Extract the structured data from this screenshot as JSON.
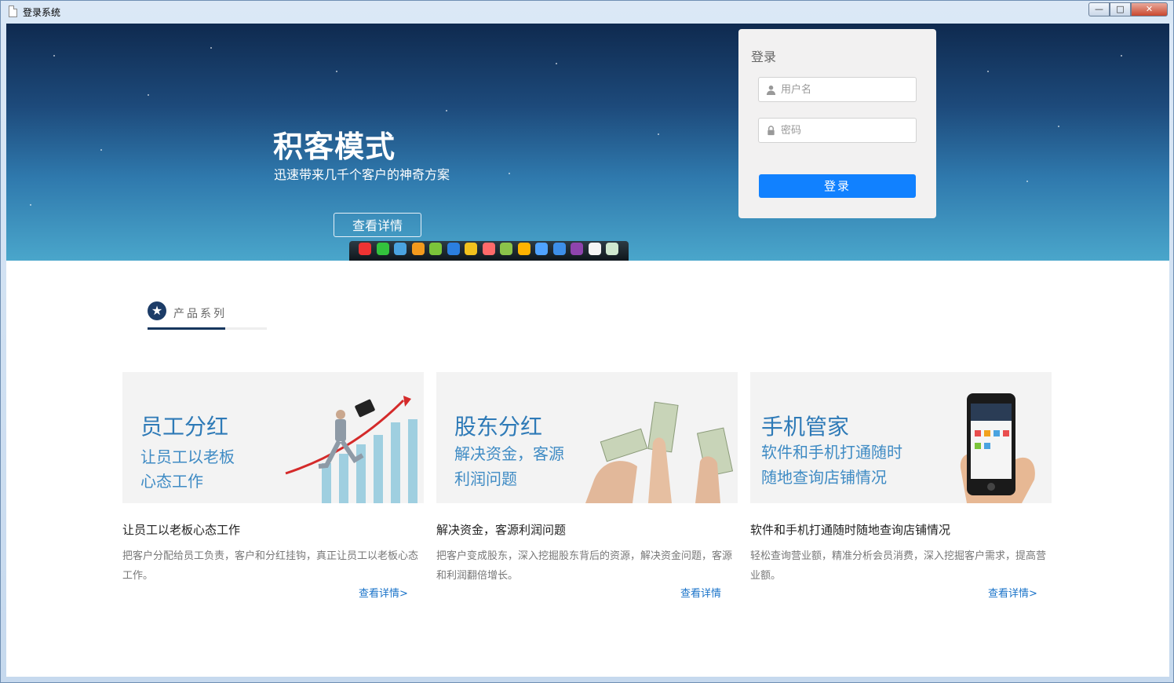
{
  "window": {
    "title": "登录系统",
    "min_symbol": "—",
    "max_symbol": "□",
    "close_symbol": "✕"
  },
  "banner": {
    "title": "积客模式",
    "subtitle": "迅速带来几千个客户的神奇方案",
    "button_label": "查看详情",
    "dock_icon_colors": [
      "#e33",
      "#33c33d",
      "#4aa3e0",
      "#f39a1d",
      "#7bc43a",
      "#2b7fe0",
      "#f2c21d",
      "#ff6a6a",
      "#8bc34a",
      "#ffb300",
      "#4fa3ff",
      "#3d8fe8",
      "#8e44ad",
      "#f5f5f5",
      "#cfe8cf"
    ]
  },
  "login": {
    "title": "登录",
    "username_placeholder": "用户名",
    "password_placeholder": "密码",
    "submit_label": "登录"
  },
  "section": {
    "label": "产品系列",
    "icon": "★"
  },
  "cards": [
    {
      "headline": "员工分红",
      "line1": "让员工以老板",
      "line2": "心态工作",
      "title": "让员工以老板心态工作",
      "desc": "把客户分配给员工负责，客户和分红挂钩，真正让员工以老板心态工作。",
      "link": "查看详情>"
    },
    {
      "headline": "股东分红",
      "line1": "解决资金，客源",
      "line2": "利润问题",
      "title": "解决资金，客源利润问题",
      "desc": "把客户变成股东，深入挖掘股东背后的资源，解决资金问题，客源和利润翻倍增长。",
      "link": "查看详情"
    },
    {
      "headline": "手机管家",
      "line1": "软件和手机打通随时",
      "line2": "随地查询店铺情况",
      "title": "软件和手机打通随时随地查询店铺情况",
      "desc": "轻松查询营业额，精准分析会员消费，深入挖掘客户需求，提高营业额。",
      "link": "查看详情>"
    }
  ]
}
